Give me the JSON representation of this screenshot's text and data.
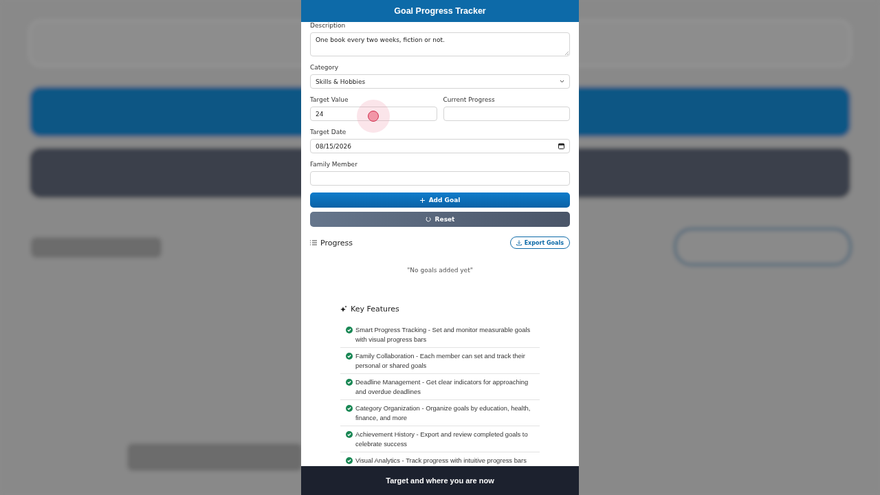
{
  "header": {
    "title": "Goal Progress Tracker"
  },
  "form": {
    "rows": [
      {
        "fields": [
          {
            "kind": "textarea",
            "label": "Description",
            "value": "One book every two weeks, fiction or not."
          }
        ]
      },
      {
        "fields": [
          {
            "kind": "select",
            "label": "Category",
            "value": "Skills & Hobbies"
          }
        ]
      },
      {
        "fields": [
          {
            "kind": "text",
            "label": "Target Value",
            "value": "24"
          },
          {
            "kind": "text",
            "label": "Current Progress"
          }
        ]
      },
      {
        "fields": [
          {
            "kind": "date",
            "label": "Target Date",
            "value": "08/15/2026"
          }
        ]
      },
      {
        "fields": [
          {
            "kind": "text",
            "label": "Family Member"
          }
        ]
      }
    ],
    "buttons": [
      {
        "kind": "primary",
        "label": "Add Goal"
      },
      {
        "kind": "secondary",
        "label": "Reset"
      }
    ]
  },
  "progress": {
    "title": "Progress",
    "export_button": "Export Goals",
    "empty_message": "\"No goals added yet\""
  },
  "key_features": {
    "title": "Key Features",
    "items": [
      "Smart Progress Tracking - Set and monitor measurable goals with visual progress bars",
      "Family Collaboration - Each member can set and track their personal or shared goals",
      "Deadline Management - Get clear indicators for approaching and overdue deadlines",
      "Category Organization - Organize goals by education, health, finance, and more",
      "Achievement History - Export and review completed goals to celebrate success",
      "Visual Analytics - Track progress with intuitive progress bars"
    ]
  },
  "caption": "Target and where you are now"
}
